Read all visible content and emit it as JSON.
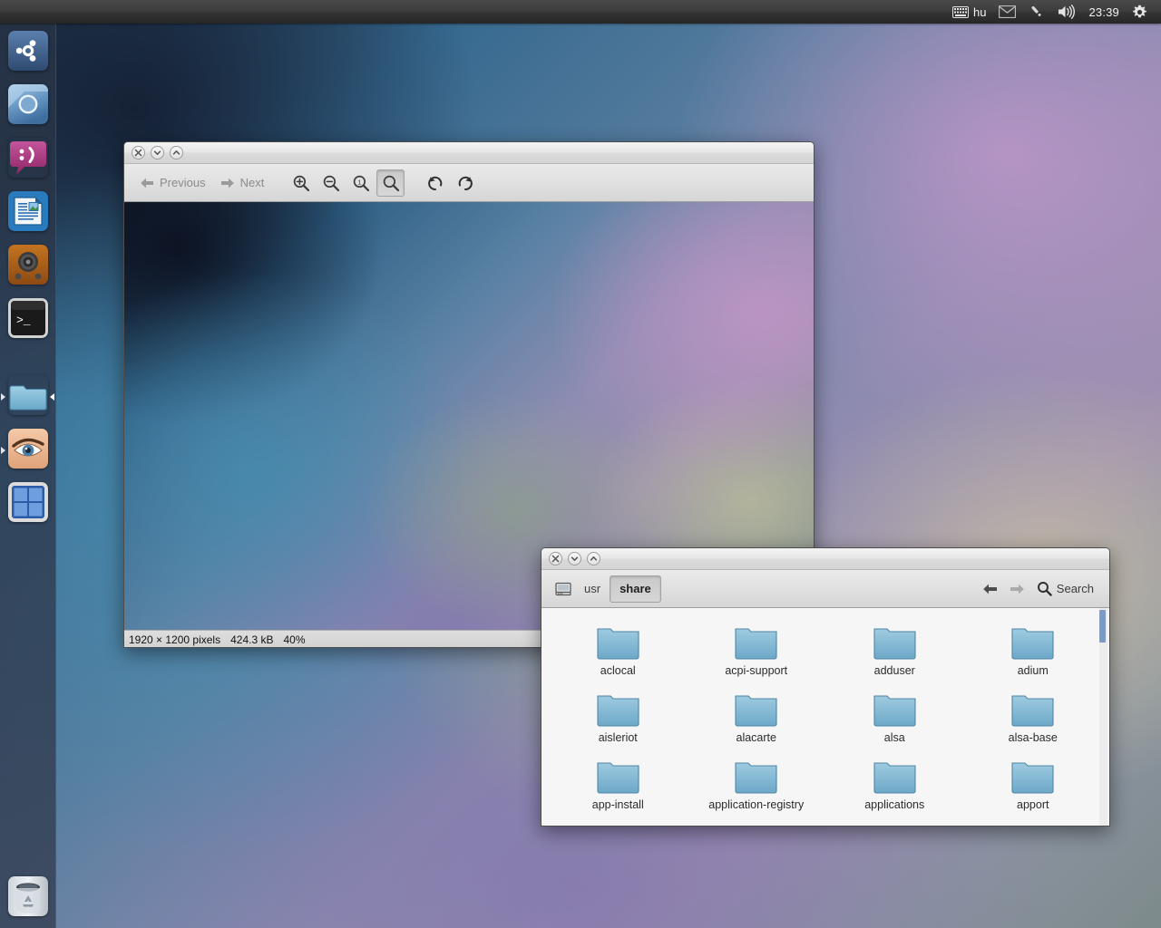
{
  "top_panel": {
    "keyboard_icon": "keyboard-icon",
    "keyboard_layout": "hu",
    "mail_icon": "envelope-icon",
    "bluetooth_icon": "bluetooth-icon",
    "volume_icon": "speaker-volume-icon",
    "clock": "23:39",
    "session_icon": "gear-icon"
  },
  "launcher": {
    "items": [
      {
        "name": "dash-home",
        "label": "Ubuntu Dash Home",
        "icon": "ubuntu-logo-icon",
        "running": false
      },
      {
        "name": "chromium-browser",
        "label": "Chromium Web Browser",
        "icon": "chromium-icon",
        "running": false
      },
      {
        "name": "empathy",
        "label": "Empathy Internet Messaging",
        "icon": "chat-bubble-icon",
        "running": false
      },
      {
        "name": "libreoffice-writer",
        "label": "LibreOffice Writer",
        "icon": "document-icon",
        "running": false
      },
      {
        "name": "rhythmbox",
        "label": "Rhythmbox Music Player",
        "icon": "speaker-icon",
        "running": false
      },
      {
        "name": "terminal",
        "label": "Terminal",
        "icon": "terminal-icon",
        "running": false
      },
      {
        "name": "files",
        "label": "Files",
        "icon": "folder-icon",
        "running": true
      },
      {
        "name": "image-viewer",
        "label": "Image Viewer",
        "icon": "eye-icon",
        "running": true
      },
      {
        "name": "workspace-switcher",
        "label": "Workspace Switcher",
        "icon": "workspace-grid-icon",
        "running": false
      }
    ],
    "trash": {
      "name": "trash",
      "label": "Trash",
      "icon": "trash-icon"
    }
  },
  "image_viewer": {
    "title": "",
    "window_buttons": {
      "close": "close-icon",
      "minimize": "minimize-icon",
      "maximize": "maximize-icon"
    },
    "toolbar": {
      "previous_label": "Previous",
      "next_label": "Next",
      "zoom_in": "zoom-in-icon",
      "zoom_out": "zoom-out-icon",
      "normal_size": "zoom-original-icon",
      "best_fit": "zoom-best-fit-icon",
      "rotate_left": "rotate-counterclockwise-icon",
      "rotate_right": "rotate-clockwise-icon"
    },
    "status": {
      "dimensions": "1920 × 1200 pixels",
      "filesize": "424.3 kB",
      "zoom": "40%"
    }
  },
  "file_manager": {
    "window_buttons": {
      "close": "close-icon",
      "minimize": "minimize-icon",
      "maximize": "maximize-icon"
    },
    "breadcrumb": {
      "device_icon": "computer-icon",
      "items": [
        {
          "label": "usr",
          "current": false
        },
        {
          "label": "share",
          "current": true
        }
      ]
    },
    "back_icon": "arrow-left-icon",
    "forward_icon": "arrow-right-icon",
    "search_label": "Search",
    "search_icon": "magnifier-icon",
    "files": [
      {
        "name": "aclocal",
        "type": "folder"
      },
      {
        "name": "acpi-support",
        "type": "folder"
      },
      {
        "name": "adduser",
        "type": "folder"
      },
      {
        "name": "adium",
        "type": "folder"
      },
      {
        "name": "aisleriot",
        "type": "folder"
      },
      {
        "name": "alacarte",
        "type": "folder"
      },
      {
        "name": "alsa",
        "type": "folder"
      },
      {
        "name": "alsa-base",
        "type": "folder"
      },
      {
        "name": "app-install",
        "type": "folder"
      },
      {
        "name": "application-registry",
        "type": "folder"
      },
      {
        "name": "applications",
        "type": "folder"
      },
      {
        "name": "apport",
        "type": "folder"
      }
    ]
  },
  "colors": {
    "panel_bg": "#333333",
    "folder_blue": "#7fb4d4",
    "scrollbar_thumb": "#7e99c2",
    "accent_orange": "#dd4814"
  }
}
